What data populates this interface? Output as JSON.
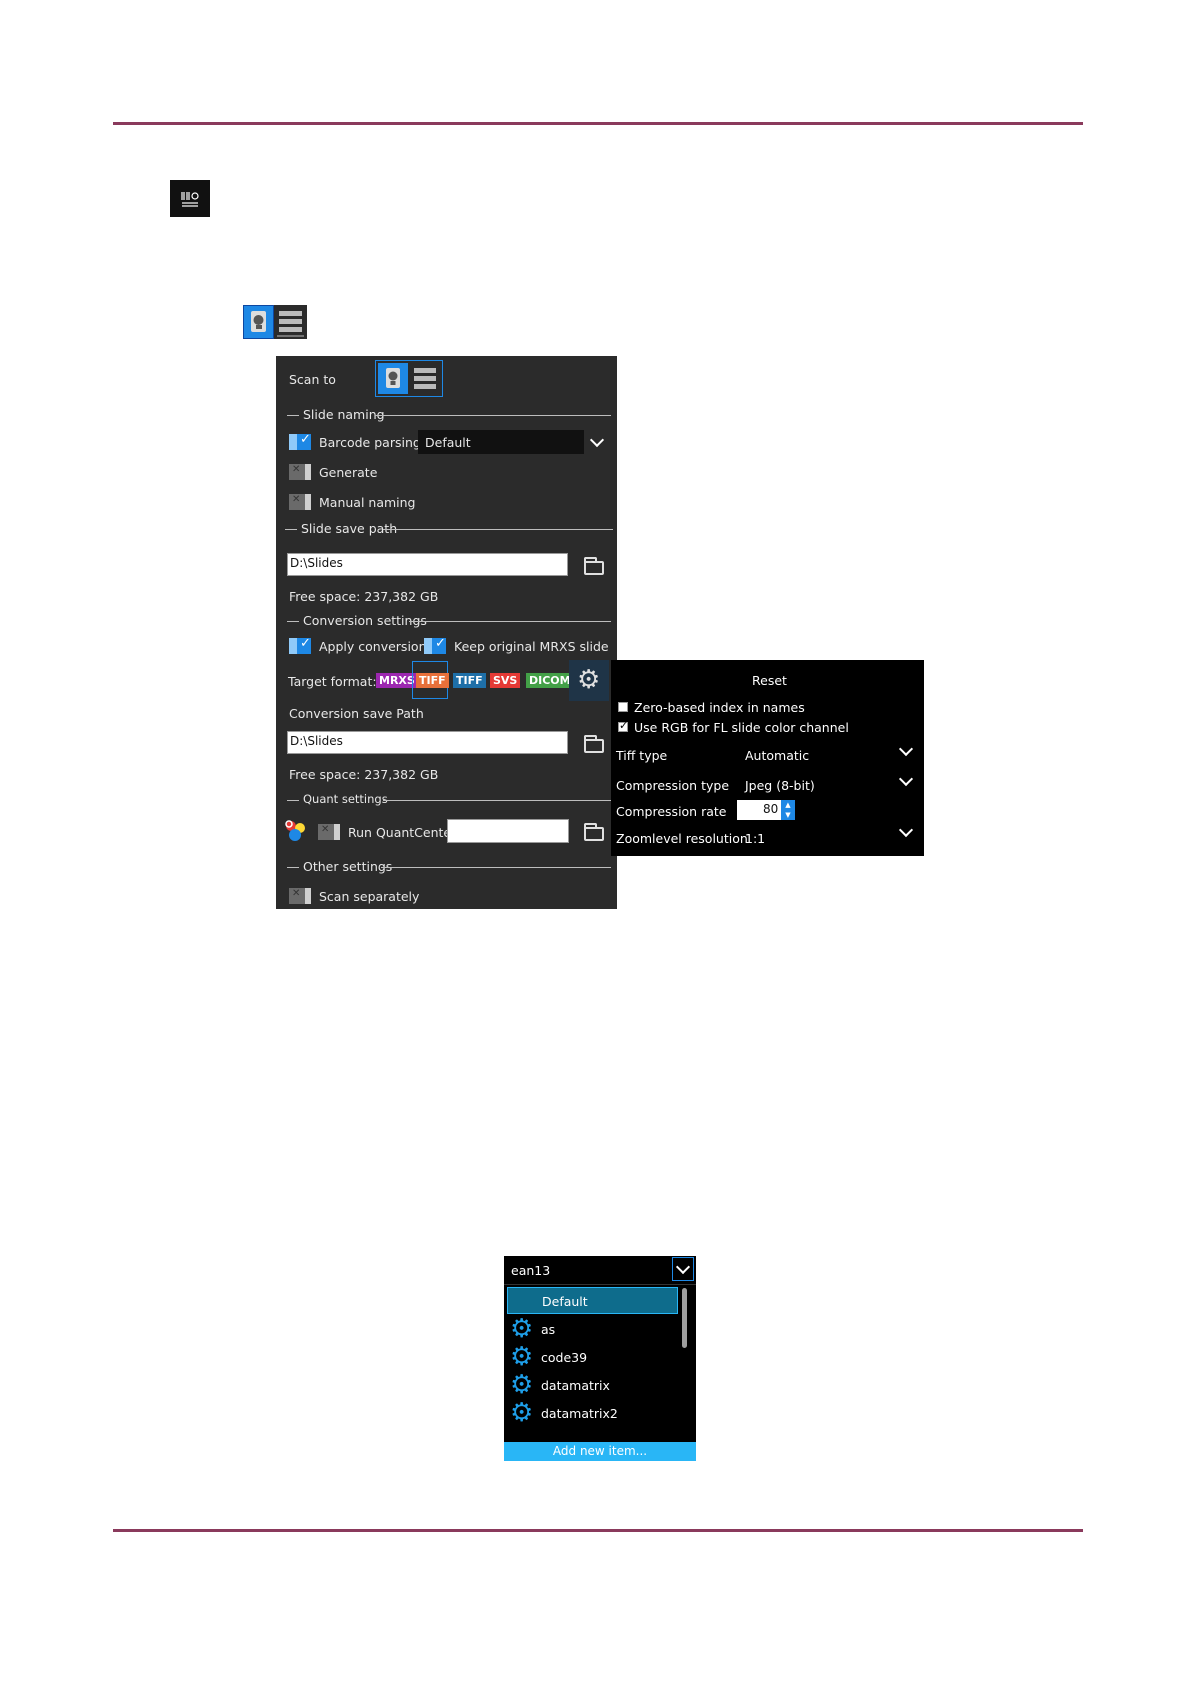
{
  "scan_to": {
    "label": "Scan to"
  },
  "slide_naming": {
    "heading": "Slide naming",
    "barcode_parsing": {
      "label": "Barcode parsing",
      "checked": true,
      "value": "Default"
    },
    "generate": {
      "label": "Generate",
      "checked": false
    },
    "manual_naming": {
      "label": "Manual naming",
      "checked": false
    }
  },
  "slide_save_path": {
    "heading": "Slide save path",
    "path": "D:\\Slides",
    "free_space": "Free space: 237,382 GB"
  },
  "conversion_settings": {
    "heading": "Conversion settings",
    "apply_conversion": {
      "label": "Apply conversion",
      "checked": true
    },
    "keep_original": {
      "label": "Keep original MRXS slide",
      "checked": true
    },
    "target_format_label": "Target format:",
    "formats": [
      {
        "label": "MRXS",
        "color": "#9c27b0"
      },
      {
        "label": "TIFF",
        "color": "#e8703a"
      },
      {
        "label": "TIFF",
        "color": "#1e6fa8"
      },
      {
        "label": "SVS",
        "color": "#e53935"
      },
      {
        "label": "DICOM",
        "color": "#43a047"
      }
    ],
    "save_path_label": "Conversion save Path",
    "save_path": "D:\\Slides",
    "free_space": "Free space: 237,382 GB"
  },
  "quant_settings": {
    "heading": "Quant settings",
    "run_quantcenter": {
      "label": "Run QuantCenter",
      "checked": false
    }
  },
  "other_settings": {
    "heading": "Other settings",
    "scan_separately": {
      "label": "Scan separately",
      "checked": false
    }
  },
  "tiff_options": {
    "reset": "Reset",
    "zero_based": {
      "label": "Zero-based index in names",
      "checked": false
    },
    "use_rgb": {
      "label": "Use RGB for FL slide color channel",
      "checked": true
    },
    "tiff_type": {
      "label": "Tiff type",
      "value": "Automatic"
    },
    "compression_type": {
      "label": "Compression type",
      "value": "Jpeg (8-bit)"
    },
    "compression_rate": {
      "label": "Compression rate",
      "value": "80"
    },
    "zoomlevel": {
      "label": "Zoomlevel resolution",
      "value": "1:1"
    }
  },
  "barcode_dropdown": {
    "selected": "ean13",
    "items": [
      "Default",
      "as",
      "code39",
      "datamatrix",
      "datamatrix2"
    ],
    "add_new": "Add new item..."
  },
  "colors": {
    "accent": "#1e88e5",
    "rule": "#8a3a5c",
    "dropdown_highlight": "#0e6c8c",
    "add_new": "#29b6f6"
  }
}
